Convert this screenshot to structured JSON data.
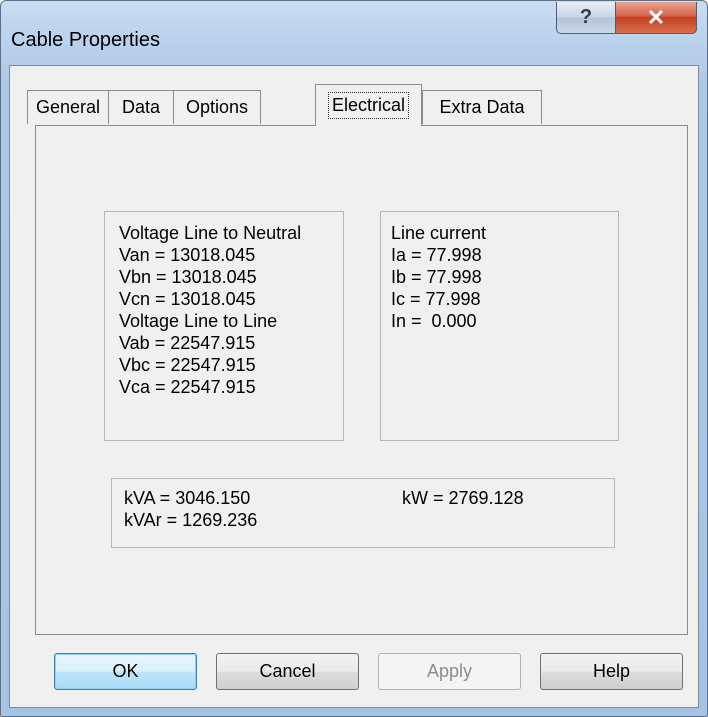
{
  "window": {
    "title": "Cable Properties",
    "help_glyph": "?",
    "close_glyph": "✕"
  },
  "tabs": [
    {
      "label": "General"
    },
    {
      "label": "Data"
    },
    {
      "label": "Options"
    },
    {
      "label": "Electrical"
    },
    {
      "label": "Extra Data"
    }
  ],
  "voltage": {
    "lines": [
      "Voltage Line to Neutral",
      "Van = 13018.045",
      "Vbn = 13018.045",
      "Vcn = 13018.045",
      "Voltage Line to Line",
      "Vab = 22547.915",
      "Vbc = 22547.915",
      "Vca = 22547.915"
    ]
  },
  "current": {
    "lines": [
      "Line current",
      "Ia = 77.998",
      "Ib = 77.998",
      "Ic = 77.998",
      "In =  0.000"
    ]
  },
  "power": {
    "kva": "kVA = 3046.150",
    "kvar": "kVAr = 1269.236",
    "kw": "kW = 2769.128"
  },
  "buttons": {
    "ok": "OK",
    "cancel": "Cancel",
    "apply_mnemonic": "A",
    "apply_rest": "pply",
    "help": "Help"
  }
}
